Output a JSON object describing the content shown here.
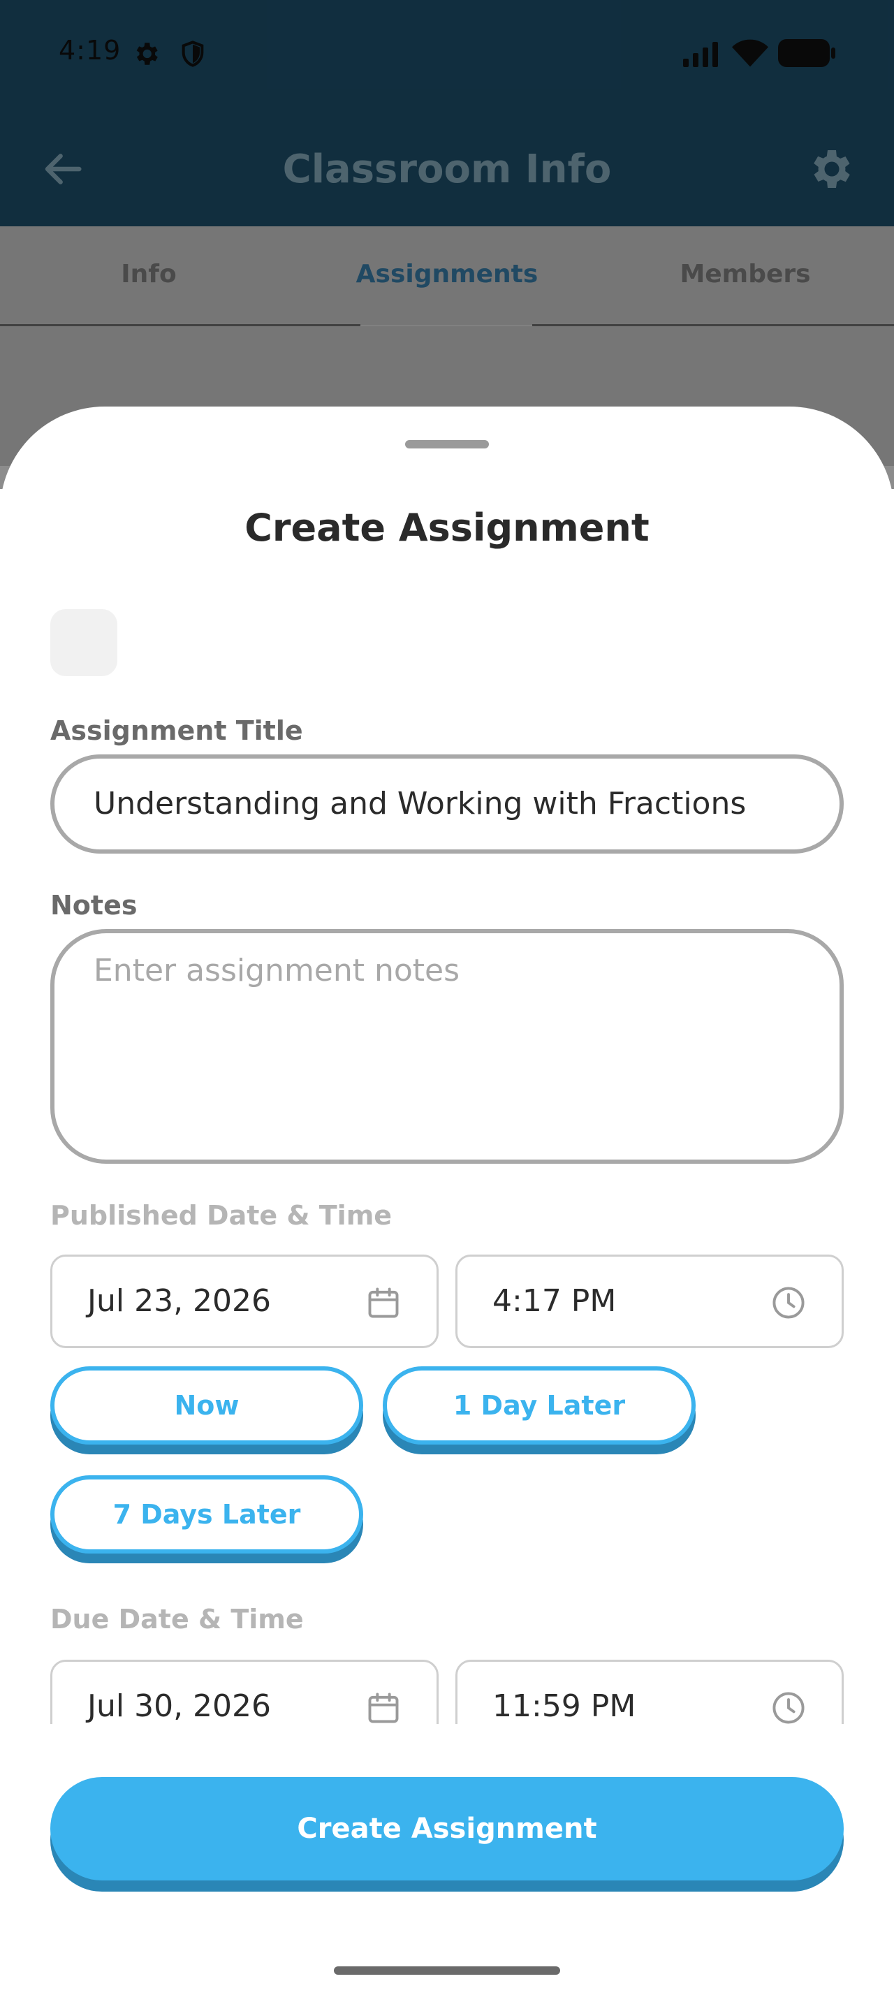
{
  "status_bar": {
    "time": "4:19"
  },
  "app_bar": {
    "title": "Classroom Info"
  },
  "tabs": [
    {
      "label": "Info"
    },
    {
      "label": "Assignments"
    },
    {
      "label": "Members"
    }
  ],
  "sheet": {
    "title": "Create Assignment",
    "title_field": {
      "label": "Assignment Title",
      "value": "Understanding and Working with Fractions"
    },
    "notes_field": {
      "label": "Notes",
      "placeholder": "Enter assignment notes"
    },
    "published": {
      "label": "Published Date & Time",
      "date": "Jul 23, 2026",
      "time": "4:17 PM",
      "quick_buttons": [
        "Now",
        "1 Day Later",
        "7 Days Later"
      ]
    },
    "due": {
      "label": "Due Date & Time",
      "date": "Jul 30, 2026",
      "time": "11:59 PM"
    },
    "submit_label": "Create Assignment"
  },
  "colors": {
    "app_bar": "#1f5472",
    "accent": "#3bb3ee",
    "accent_shadow": "#2a86b6"
  }
}
